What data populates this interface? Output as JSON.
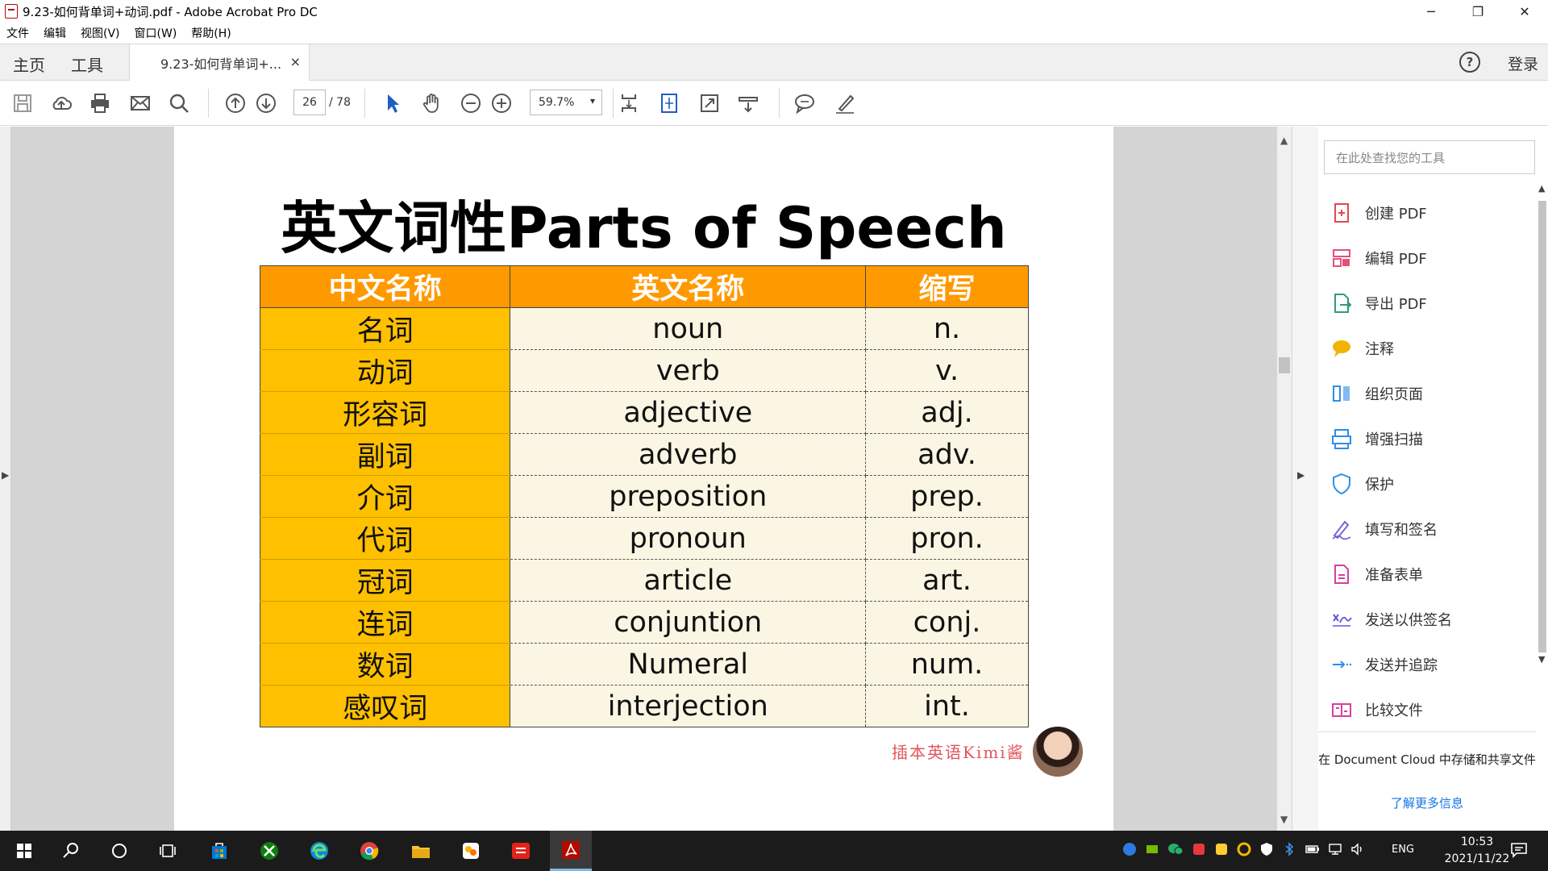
{
  "window": {
    "title": "9.23-如何背单词+动词.pdf - Adobe Acrobat Pro DC",
    "buttons": [
      "─",
      "❐",
      "✕"
    ]
  },
  "menubar": [
    "文件",
    "编辑",
    "视图(V)",
    "窗口(W)",
    "帮助(H)"
  ],
  "tabs": {
    "home": "主页",
    "tools": "工具",
    "document": "9.23-如何背单词+...",
    "close": "×",
    "help": "?",
    "login": "登录"
  },
  "toolbar": {
    "page_current": "26",
    "page_total": "/ 78",
    "zoom": "59.7%",
    "zoom_caret": "▾"
  },
  "document": {
    "title": "英文词性Parts of Speech",
    "headers": [
      "中文名称",
      "英文名称",
      "缩写"
    ],
    "rows": [
      [
        "名词",
        "noun",
        "n."
      ],
      [
        "动词",
        "verb",
        "v."
      ],
      [
        "形容词",
        "adjective",
        "adj."
      ],
      [
        "副词",
        "adverb",
        "adv."
      ],
      [
        "介词",
        "preposition",
        "prep."
      ],
      [
        "代词",
        "pronoun",
        "pron."
      ],
      [
        "冠词",
        "article",
        "art."
      ],
      [
        "连词",
        "conjuntion",
        "conj."
      ],
      [
        "数词",
        "Numeral",
        "num."
      ],
      [
        "感叹词",
        "interjection",
        "int."
      ]
    ],
    "watermark": "插本英语Kimi酱"
  },
  "right_panel": {
    "search_placeholder": "在此处查找您的工具",
    "tools": [
      {
        "label": "创建 PDF",
        "icon": "create-pdf-icon",
        "color": "#e34850"
      },
      {
        "label": "编辑 PDF",
        "icon": "edit-pdf-icon",
        "color": "#e3517b"
      },
      {
        "label": "导出 PDF",
        "icon": "export-pdf-icon",
        "color": "#2d9d78"
      },
      {
        "label": "注释",
        "icon": "comment-icon",
        "color": "#f0b400"
      },
      {
        "label": "组织页面",
        "icon": "organize-pages-icon",
        "color": "#2d8ee6"
      },
      {
        "label": "增强扫描",
        "icon": "enhance-scan-icon",
        "color": "#2d8ee6"
      },
      {
        "label": "保护",
        "icon": "protect-icon",
        "color": "#2d8ee6"
      },
      {
        "label": "填写和签名",
        "icon": "fill-sign-icon",
        "color": "#7a64d6"
      },
      {
        "label": "准备表单",
        "icon": "prepare-form-icon",
        "color": "#d6409f"
      },
      {
        "label": "发送以供签名",
        "icon": "send-signature-icon",
        "color": "#5b56d6"
      },
      {
        "label": "发送并追踪",
        "icon": "send-track-icon",
        "color": "#2d8ee6"
      },
      {
        "label": "比较文件",
        "icon": "compare-files-icon",
        "color": "#d6409f"
      }
    ],
    "cloud_text": "在 Document Cloud 中存储和共享文件",
    "cloud_link": "了解更多信息"
  },
  "taskbar": {
    "language": "ENG",
    "time": "10:53",
    "date": "2021/11/22"
  }
}
